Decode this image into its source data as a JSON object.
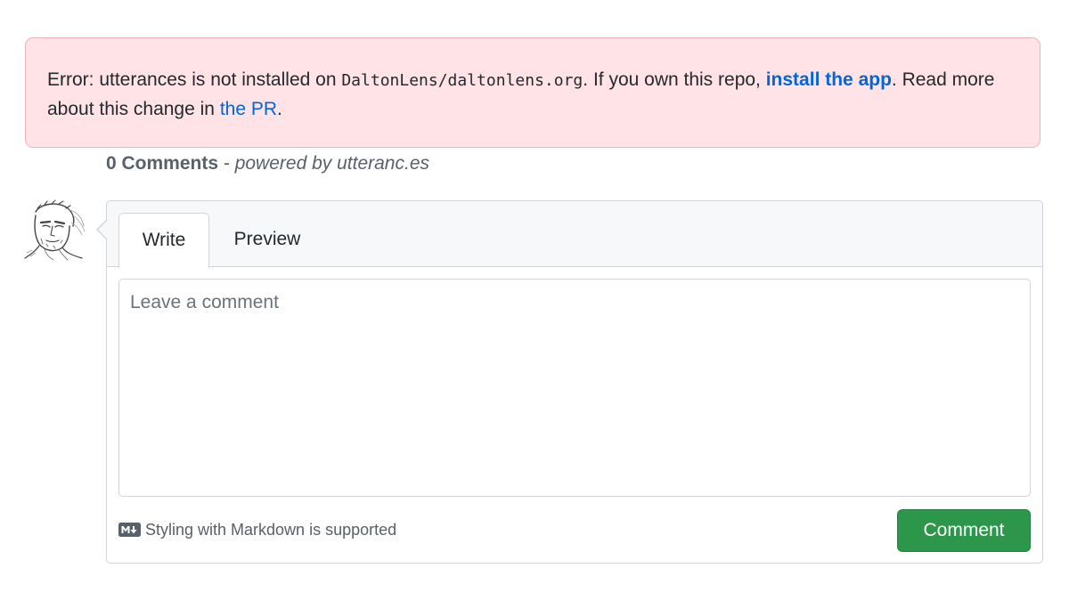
{
  "error": {
    "prefix": "Error: utterances is not installed on ",
    "repo": "DaltonLens/daltonlens.org",
    "middle": ". If you own this repo, ",
    "install_link": "install the app",
    "after_link": ". Read more about this change in ",
    "pr_link": "the PR",
    "suffix": "."
  },
  "comments": {
    "count": "0 Comments",
    "separator": " - ",
    "powered": "powered by utteranc.es"
  },
  "avatar": {
    "icon": "user-avatar-sketch"
  },
  "tabs": [
    {
      "label": "Write",
      "selected": true
    },
    {
      "label": "Preview",
      "selected": false
    }
  ],
  "editor": {
    "placeholder": "Leave a comment",
    "value": ""
  },
  "footer": {
    "markdown_icon": "markdown-icon",
    "markdown_hint": "Styling with Markdown is supported",
    "submit_label": "Comment"
  },
  "colors": {
    "error_bg": "#ffe3e6",
    "link": "#0366d6",
    "button": "#2c974b"
  }
}
